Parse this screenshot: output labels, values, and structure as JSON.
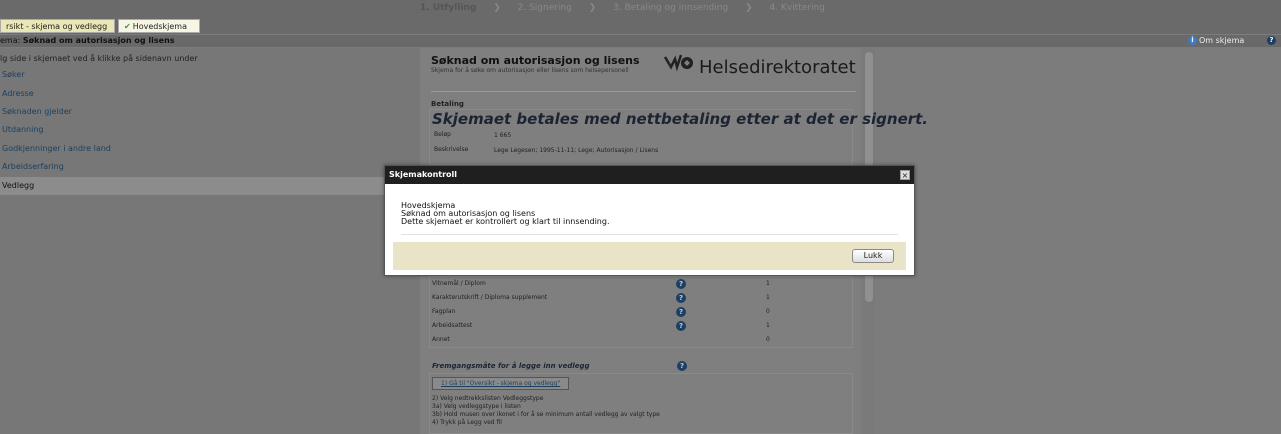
{
  "steps": [
    "1. Utfylling",
    "2. Signering",
    "3. Betaling og innsending",
    "4. Kvittering"
  ],
  "tabs": [
    {
      "label": "rsikt - skjema og vedlegg",
      "check": false
    },
    {
      "label": "Hovedskjema",
      "check": true
    }
  ],
  "title": {
    "prefix": "ema: ",
    "name": "Søknad om autorisasjon og lisens"
  },
  "help": {
    "om_skjema": "Om skjema"
  },
  "sidebar": {
    "instruction": "lg side i skjemaet ved å klikke på sidenavn under",
    "items": [
      "Søker",
      "Adresse",
      "Søknaden gjelder",
      "Utdanning",
      "Godkjenninger i andre land",
      "Arbeidserfaring",
      "Vedlegg"
    ]
  },
  "doc": {
    "form_title": "Søknad om autorisasjon og lisens",
    "form_sub": "Skjema for å søke om autorisasjon eller lisens som helsepersonell",
    "logo": "Helsedirektoratet",
    "betaling_label": "Betaling",
    "notice": "Skjemaet betales med nettbetaling etter at det er signert.",
    "belop_label": "Beløp",
    "belop_value": "1 665",
    "beskrivelse_label": "Beskrivelse",
    "beskrivelse_value": "Lege Legesen; 1995-11-11; Lege; Autorisasjon / Lisens",
    "vedlegg_rows": [
      {
        "name": "Vitnemål / Diplom",
        "count": "1"
      },
      {
        "name": "Karakterutskrift / Diploma supplement",
        "count": "1"
      },
      {
        "name": "Fagplan",
        "count": "0"
      },
      {
        "name": "Arbeidsattest",
        "count": "1"
      },
      {
        "name": "Annet",
        "count": "0"
      }
    ],
    "fremgang_label": "Fremgangsmåte for å legge inn vedlegg",
    "link_button": "1) Gå til \"Oversikt - skjema og vedlegg\"",
    "instructions": [
      "2) Velg nedtrekkslisten Vedleggstype",
      "3a) Velg vedleggstype i listen",
      "3b) Hold musen over ikonet i for å se minimum antall vedlegg av valgt type",
      "4) Trykk på Legg ved fil"
    ]
  },
  "modal": {
    "title": "Skjemakontroll",
    "close": "×",
    "line1": "Hovedskjema",
    "line2": "Søknad om autorisasjon og lisens",
    "line3": "Dette skjemaet er kontrollert og klart til innsending.",
    "button": "Lukk"
  },
  "icons": {
    "info": "i",
    "question": "?",
    "check": "✔"
  }
}
